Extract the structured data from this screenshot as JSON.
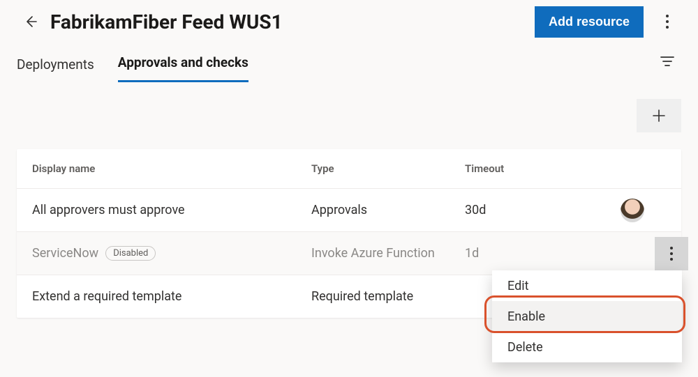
{
  "header": {
    "title": "FabrikamFiber Feed WUS1",
    "primary_button": "Add resource"
  },
  "tabs": [
    {
      "label": "Deployments",
      "active": false
    },
    {
      "label": "Approvals and checks",
      "active": true
    }
  ],
  "table": {
    "columns": {
      "name": "Display name",
      "type": "Type",
      "timeout": "Timeout"
    },
    "rows": [
      {
        "name": "All approvers must approve",
        "type": "Approvals",
        "timeout": "30d",
        "disabled": false,
        "avatar": true
      },
      {
        "name": "ServiceNow",
        "type": "Invoke Azure Function",
        "timeout": "1d",
        "disabled": true,
        "disabled_label": "Disabled",
        "show_more": true
      },
      {
        "name": "Extend a required template",
        "type": "Required template",
        "timeout": "",
        "disabled": false
      }
    ]
  },
  "menu": {
    "items": [
      {
        "label": "Edit"
      },
      {
        "label": "Enable",
        "selected": true
      },
      {
        "label": "Delete"
      }
    ]
  }
}
